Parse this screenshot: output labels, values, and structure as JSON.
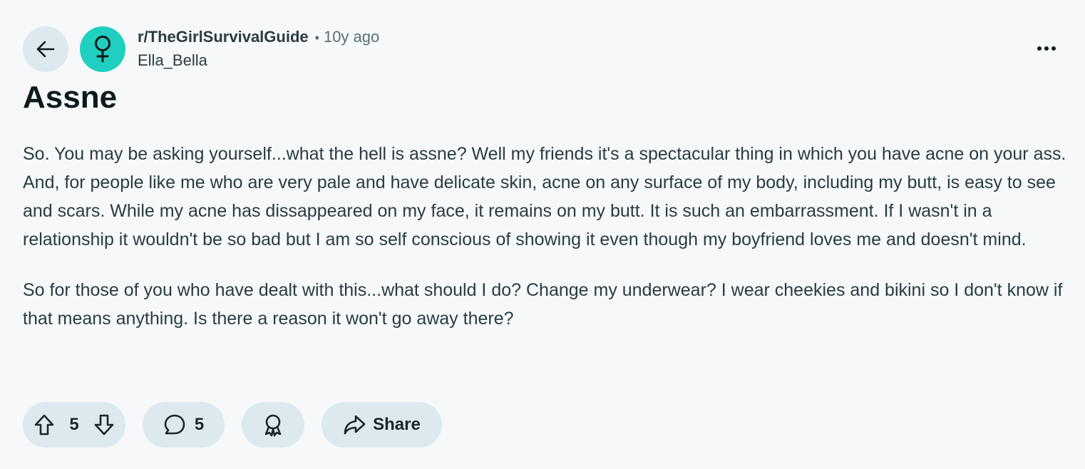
{
  "header": {
    "subreddit": "r/TheGirlSurvivalGuide",
    "separator": "•",
    "age": "10y ago",
    "author": "Ella_Bella",
    "back_icon": "arrow-left-icon",
    "avatar_icon": "female-symbol-icon",
    "more_icon": "ellipsis-icon"
  },
  "post": {
    "title": "Assne",
    "paragraphs": [
      "So. You may be asking yourself...what the hell is assne? Well my friends it's a spectacular thing in which you have acne on your ass. And, for people like me who are very pale and have delicate skin, acne on any surface of my body, including my butt, is easy to see and scars. While my acne has dissappeared on my face, it remains on my butt. It is such an embarrassment. If I wasn't in a relationship it wouldn't be so bad but I am so self conscious of showing it even though my boyfriend loves me and doesn't mind.",
      "So for those of you who have dealt with this...what should I do? Change my underwear? I wear cheekies and bikini so I don't know if that means anything. Is there a reason it won't go away there?"
    ]
  },
  "actions": {
    "score": "5",
    "comments": "5",
    "share_label": "Share",
    "upvote_icon": "upvote-arrow-icon",
    "downvote_icon": "downvote-arrow-icon",
    "comment_icon": "comment-bubble-icon",
    "award_icon": "award-icon",
    "share_icon": "share-arrow-icon"
  },
  "colors": {
    "background": "#f6f8fa",
    "pill_background": "#dde9ee",
    "avatar": "#20cfc0",
    "text_primary": "#0f1a1c",
    "text_secondary": "#576f76"
  }
}
